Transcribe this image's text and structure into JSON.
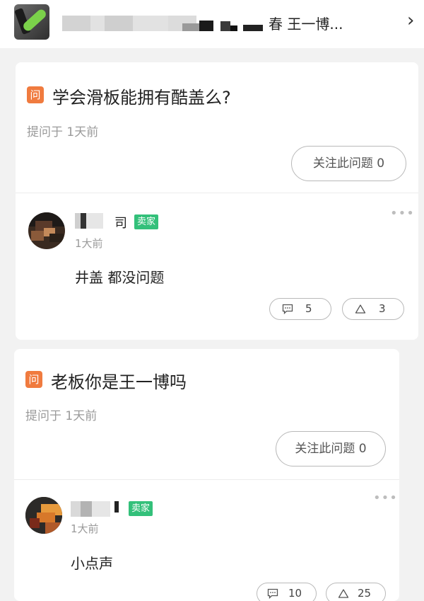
{
  "header": {
    "title": "春 王一博...",
    "chevron": "›",
    "thumbnail_icon": "product-thumbnail",
    "back_icon": "chevron-right-icon"
  },
  "questions": [
    {
      "q_icon": "问",
      "title": "学会滑板能拥有酷盖么?",
      "meta": "提问于 1天前",
      "follow_label": "关注此问题 0",
      "more": "•••",
      "answer": {
        "author_suffix": "司",
        "badge": "卖家",
        "time": "1大前",
        "text": "井盖 都没问题",
        "comment_count": "5",
        "like_count": "3"
      }
    },
    {
      "q_icon": "问",
      "title": "老板你是王一博吗",
      "meta": "提问于 1天前",
      "follow_label": "关注此问题 0",
      "more": "•••",
      "answer": {
        "author_suffix": "",
        "badge": "卖家",
        "time": "1大前",
        "text": "小点声",
        "comment_count": "10",
        "like_count": "25"
      }
    }
  ],
  "colors": {
    "accent_orange": "#f07b3f",
    "seller_green": "#33c07a",
    "muted_text": "#9a9a9a"
  }
}
